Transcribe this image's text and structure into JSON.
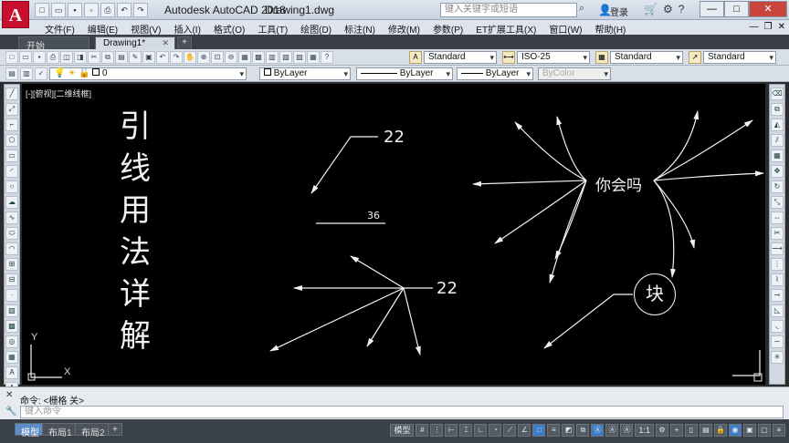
{
  "titlebar": {
    "app_logo": "A",
    "app_title": "Autodesk AutoCAD 2018",
    "doc_title": "Drawing1.dwg",
    "search_placeholder": "键入关键字或短语",
    "login_label": "登录",
    "minimize": "—",
    "maximize": "□",
    "close": "✕"
  },
  "menu": {
    "items": [
      "文件(F)",
      "编辑(E)",
      "视图(V)",
      "插入(I)",
      "格式(O)",
      "工具(T)",
      "绘图(D)",
      "标注(N)",
      "修改(M)",
      "参数(P)",
      "ET扩展工具(X)",
      "窗口(W)",
      "帮助(H)"
    ]
  },
  "tabs": {
    "start": "开始",
    "drawing": "Drawing1*",
    "drawing_close": "✕",
    "add": "+"
  },
  "toolbar": {
    "text_style": "Standard",
    "dim_style": "ISO-25",
    "table_style": "Standard",
    "mleader_style": "Standard"
  },
  "layers": {
    "current_layer": "0",
    "color": "ByLayer",
    "linetype": "ByLayer",
    "lineweight": "ByLayer",
    "plotstyle": "ByColor"
  },
  "canvas": {
    "viewport_label": "[-][俯视][二维线框]",
    "vertical_title": [
      "引",
      "线",
      "用",
      "法",
      "详",
      "解"
    ],
    "annotations": {
      "leader_a": "22",
      "dim_text": "36",
      "leader_b": "22",
      "leader_center": "你会吗",
      "block_text": "块"
    },
    "ucs_y": "Y",
    "ucs_x": "X"
  },
  "command": {
    "history": "命令:  <栅格 关>",
    "placeholder": "键入命令"
  },
  "statusbar": {
    "model": "模型",
    "layout1": "布局1",
    "layout2": "布局2",
    "add": "+",
    "model_button": "模型",
    "scale": "1:1"
  },
  "colors": {
    "canvas_bg": "#000000",
    "leader_line": "#f2f2f2",
    "logo_red": "#c8102e"
  }
}
